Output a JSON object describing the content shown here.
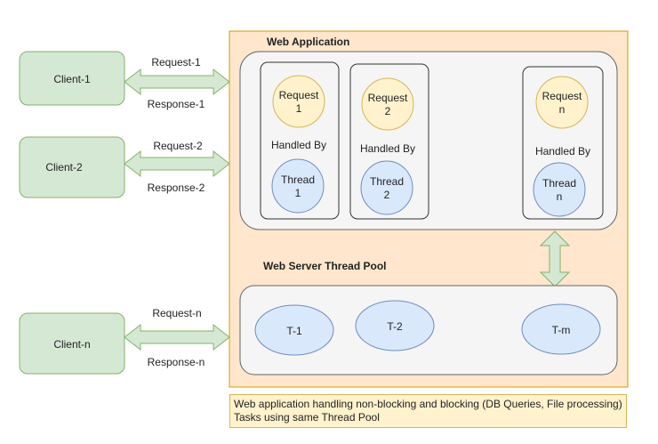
{
  "clients": [
    {
      "label": "Client-1",
      "request": "Request-1",
      "response": "Response-1"
    },
    {
      "label": "Client-2",
      "request": "Request-2",
      "response": "Response-2"
    },
    {
      "label": "Client-n",
      "request": "Request-n",
      "response": "Response-n"
    }
  ],
  "web_app": {
    "title": "Web Application",
    "handlers": [
      {
        "request": [
          "Request",
          "1"
        ],
        "handled_by": "Handled By",
        "thread": [
          "Thread",
          "1"
        ]
      },
      {
        "request": [
          "Request",
          "2"
        ],
        "handled_by": "Handled By",
        "thread": [
          "Thread",
          "2"
        ]
      },
      {
        "request": [
          "Request",
          "n"
        ],
        "handled_by": "Handled By",
        "thread": [
          "Thread",
          "n"
        ]
      }
    ]
  },
  "thread_pool": {
    "title": "Web Server Thread Pool",
    "threads": [
      "T-1",
      "T-2",
      "T-m"
    ]
  },
  "caption": "Web application handling non-blocking and blocking (DB Queries, File processing) Tasks using same Thread Pool",
  "colors": {
    "client_fill": "#d5e8d4",
    "client_stroke": "#82b366",
    "server_fill": "#ffe6cc",
    "server_stroke": "#d79b00",
    "panel_fill": "#f5f5f5",
    "panel_stroke": "#666666",
    "request_fill": "#fff2cc",
    "request_stroke": "#d6b656",
    "thread_fill": "#dae8fc",
    "thread_stroke": "#6c8ebf"
  }
}
